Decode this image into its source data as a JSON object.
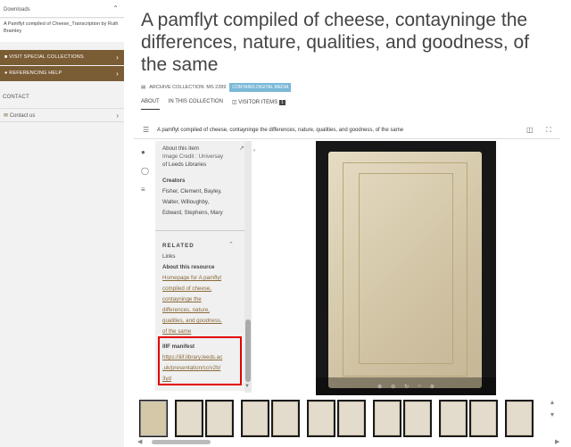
{
  "sidebar": {
    "downloads_label": "Downloads",
    "download_file_label": "A Pamflyt compiled of Cheese_Transcription by Ruth Bramley",
    "visit_special_collections": "VISIT SPECIAL COLLECTIONS",
    "referencing_help": "REFERENCING HELP",
    "contact_heading": "CONTACT",
    "contact_us": "Contact us"
  },
  "header": {
    "title": "A pamflyt compiled of cheese, contayninge the differences, nature, qualities, and goodness, of the same",
    "meta_label": "ARCHIVE COLLECTION: MS 2289",
    "media_badge": "CONTAINS DIGITAL MEDIA"
  },
  "tabs": [
    {
      "label": "ABOUT"
    },
    {
      "label": "IN THIS COLLECTION"
    },
    {
      "label": "VISITOR ITEMS",
      "count": "1"
    }
  ],
  "viewer": {
    "title": "A pamflyt compiled of cheese, contayninge the differences, nature, qualities, and goodness, of the same",
    "info_panel": {
      "heading": "About this item",
      "image_credit_fragment": "Image Credit : Universay",
      "image_credit_line2": "of Leeds Libraries",
      "creators_heading": "Creators",
      "creators_lines": [
        "Fisher, Clement, Bayley,",
        "Walter, Willoughby,",
        "Edward, Stephens, Mary"
      ],
      "related_heading": "RELATED",
      "links_label": "Links",
      "about_resource_heading": "About this resource",
      "homepage_link_lines": [
        "Homepage for A pamflyt",
        "compiled of cheese,",
        "contayninge the",
        "differences, nature,",
        "qualities, and goodness,",
        "of the same"
      ],
      "iiif_heading": "IIIF manifest",
      "iiif_link_lines": [
        "https://iiif.library.leeds.ac",
        ".uk/presentation/cc/v2b/",
        "3yd"
      ]
    }
  },
  "colors": {
    "accent_brown": "#7a5c35",
    "badge_blue": "#7ab8d8",
    "highlight_red": "#e30000"
  }
}
